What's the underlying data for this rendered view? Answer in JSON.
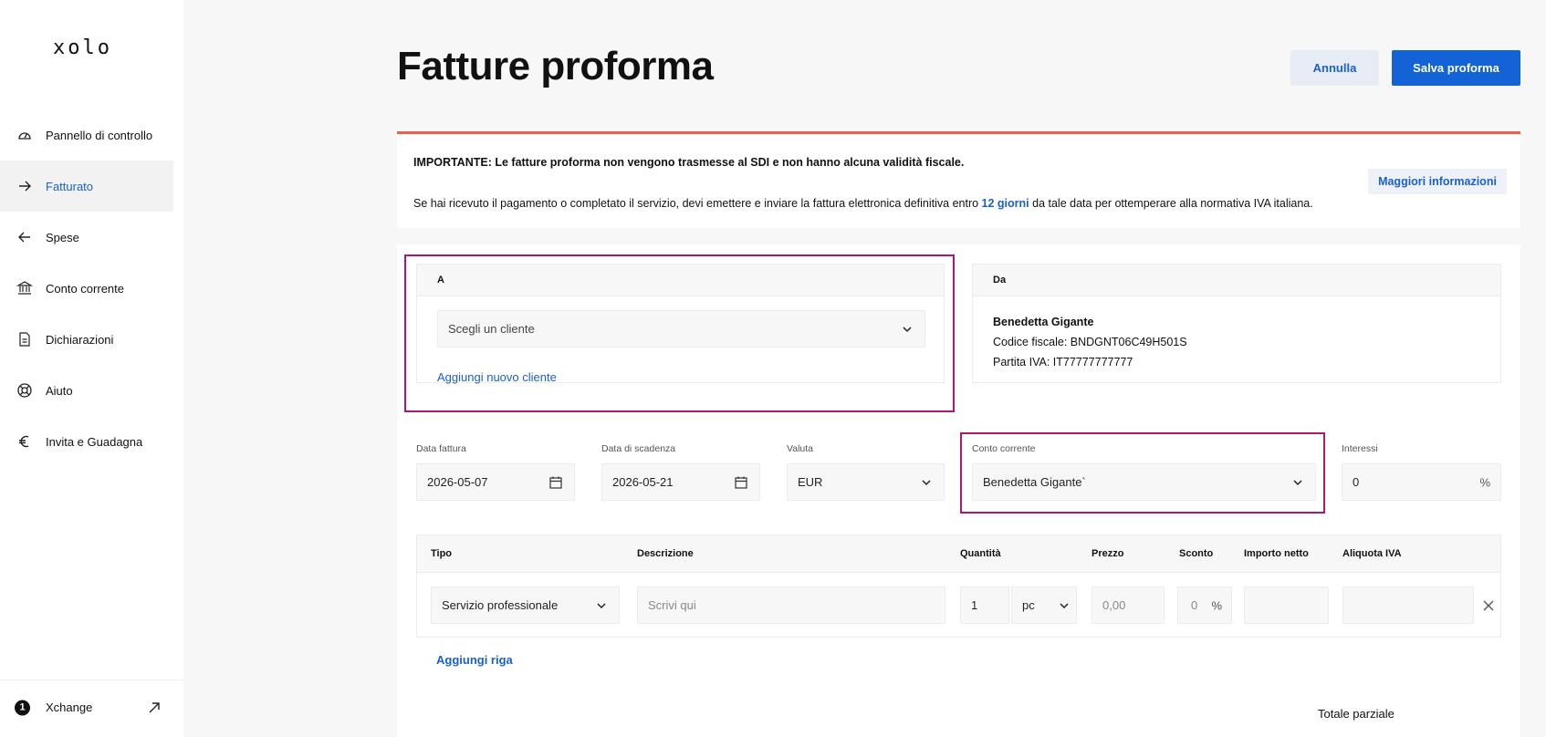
{
  "sidebar": {
    "logo": "xolo",
    "items": [
      {
        "label": "Pannello di controllo",
        "icon": "gauge-icon"
      },
      {
        "label": "Fatturato",
        "icon": "arrow-right-icon",
        "active": true
      },
      {
        "label": "Spese",
        "icon": "arrow-left-icon"
      },
      {
        "label": "Conto corrente",
        "icon": "bank-icon"
      },
      {
        "label": "Dichiarazioni",
        "icon": "document-icon"
      },
      {
        "label": "Aiuto",
        "icon": "lifebuoy-icon"
      },
      {
        "label": "Invita e Guadagna",
        "icon": "euro-icon"
      }
    ],
    "footer": {
      "badge": "1",
      "label": "Xchange",
      "icon": "external-link-icon"
    }
  },
  "header": {
    "title": "Fatture proforma",
    "cancel_label": "Annulla",
    "save_label": "Salva proforma"
  },
  "alert": {
    "strong": "IMPORTANTE: Le fatture proforma non vengono trasmesse al SDI e non hanno alcuna validità fiscale.",
    "text_before": "Se hai ricevuto il pagamento o completato il servizio, devi emettere e inviare la fattura elettronica definitiva entro ",
    "highlight": "12 giorni",
    "text_after": " da tale data per ottemperare alla normativa IVA italiana.",
    "link": "Maggiori informazioni",
    "accent_color": "#e9604f"
  },
  "to_box": {
    "heading": "A",
    "select_value": "Scegli un cliente",
    "add_client": "Aggiungi nuovo cliente"
  },
  "from_box": {
    "heading": "Da",
    "name": "Benedetta Gigante",
    "tax_code": "Codice fiscale: BNDGNT06C49H501S",
    "vat": "Partita IVA: IT77777777777"
  },
  "fields": {
    "invoice_date": {
      "label": "Data fattura",
      "value": "2026-05-07"
    },
    "due_date": {
      "label": "Data di scadenza",
      "value": "2026-05-21"
    },
    "currency": {
      "label": "Valuta",
      "value": "EUR"
    },
    "account": {
      "label": "Conto corrente",
      "value": "Benedetta Gigante`"
    },
    "interest": {
      "label": "Interessi",
      "value": "0",
      "unit": "%"
    }
  },
  "table": {
    "headers": [
      "Tipo",
      "Descrizione",
      "Quantità",
      "Prezzo",
      "Sconto",
      "Importo netto",
      "Aliquota IVA"
    ],
    "row": {
      "type": "Servizio professionale",
      "description_placeholder": "Scrivi qui",
      "quantity": "1",
      "unit": "pc",
      "price_placeholder": "0,00",
      "discount": "0",
      "discount_unit": "%"
    },
    "add_row": "Aggiungi riga"
  },
  "totals": {
    "subtotal_label": "Totale parziale"
  },
  "colors": {
    "primary": "#1463d6",
    "link": "#1a5fd0",
    "highlight_border": "#b0166d"
  }
}
